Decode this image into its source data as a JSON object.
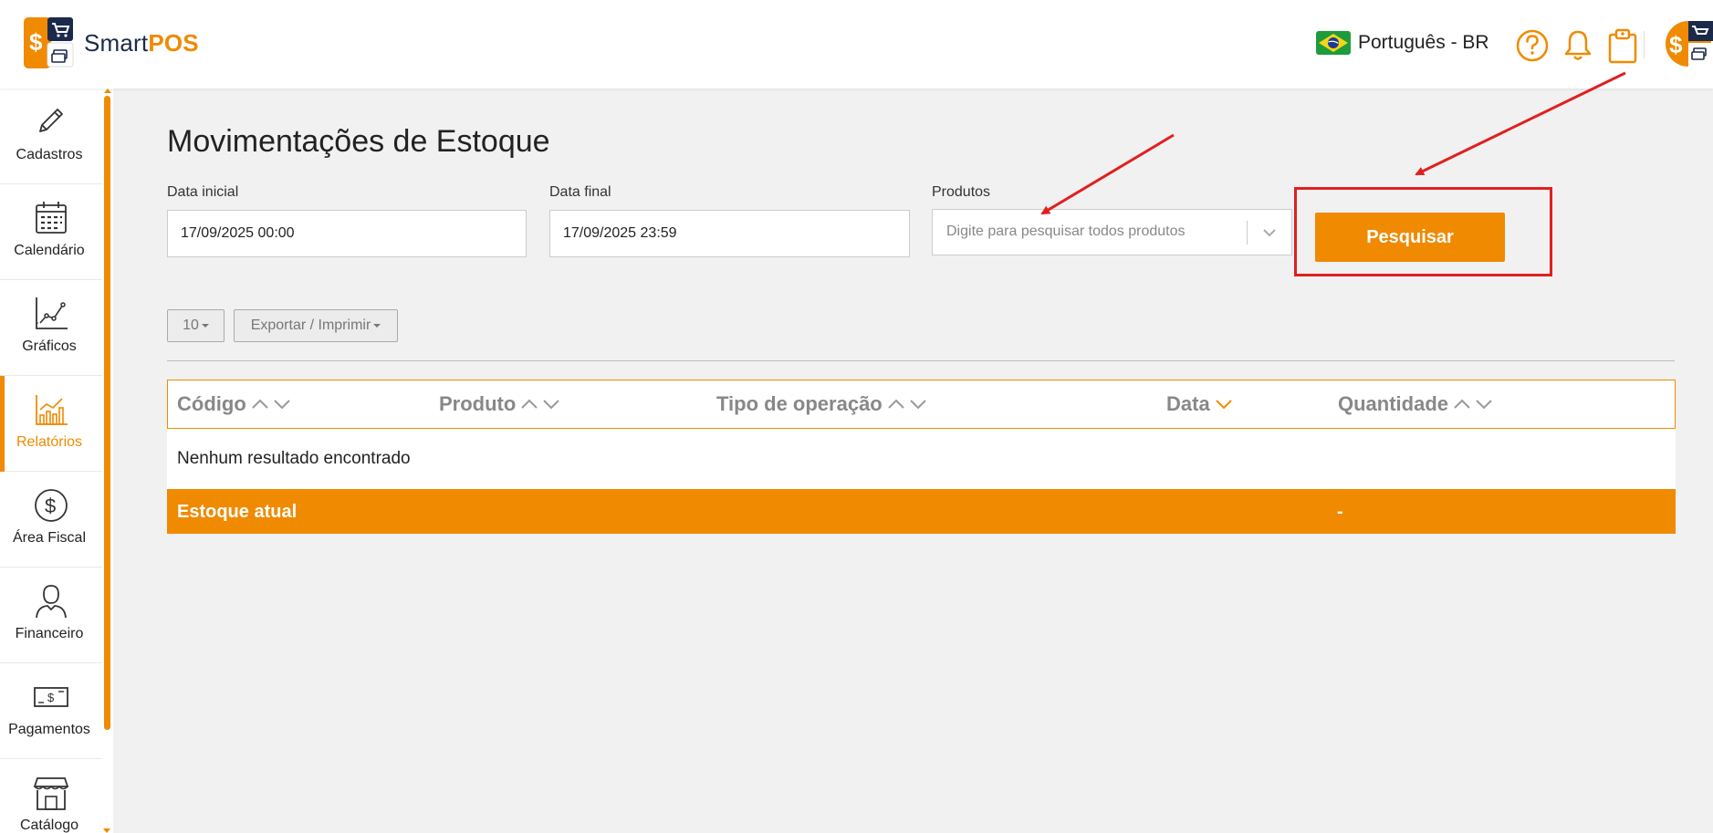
{
  "app": {
    "brand_smart": "Smart",
    "brand_pos": "POS"
  },
  "header": {
    "language": "Português - BR"
  },
  "sidebar": {
    "items": [
      {
        "label": "Cadastros",
        "icon": "pencil-icon"
      },
      {
        "label": "Calendário",
        "icon": "calendar-icon"
      },
      {
        "label": "Gráficos",
        "icon": "line-chart-icon"
      },
      {
        "label": "Relatórios",
        "icon": "bar-chart-icon",
        "active": true
      },
      {
        "label": "Área Fiscal",
        "icon": "dollar-circle-icon"
      },
      {
        "label": "Financeiro",
        "icon": "person-icon"
      },
      {
        "label": "Pagamentos",
        "icon": "banknote-icon"
      },
      {
        "label": "Catálogo",
        "icon": "store-icon"
      }
    ]
  },
  "page": {
    "title": "Movimentações de Estoque"
  },
  "filters": {
    "start_label": "Data inicial",
    "start_value": "17/09/2025 00:00",
    "end_label": "Data final",
    "end_value": "17/09/2025 23:59",
    "products_label": "Produtos",
    "products_placeholder": "Digite para pesquisar todos produtos",
    "search_button": "Pesquisar"
  },
  "toolbar": {
    "page_size": "10",
    "export_label": "Exportar / Imprimir"
  },
  "table": {
    "columns": [
      "Código",
      "Produto",
      "Tipo de operação",
      "Data",
      "Quantidade"
    ],
    "empty_message": "Nenhum resultado encontrado",
    "total_label": "Estoque atual",
    "total_value": "-"
  },
  "colors": {
    "accent": "#f08a00",
    "navy": "#1b2a4a",
    "annotation": "#e02020"
  }
}
